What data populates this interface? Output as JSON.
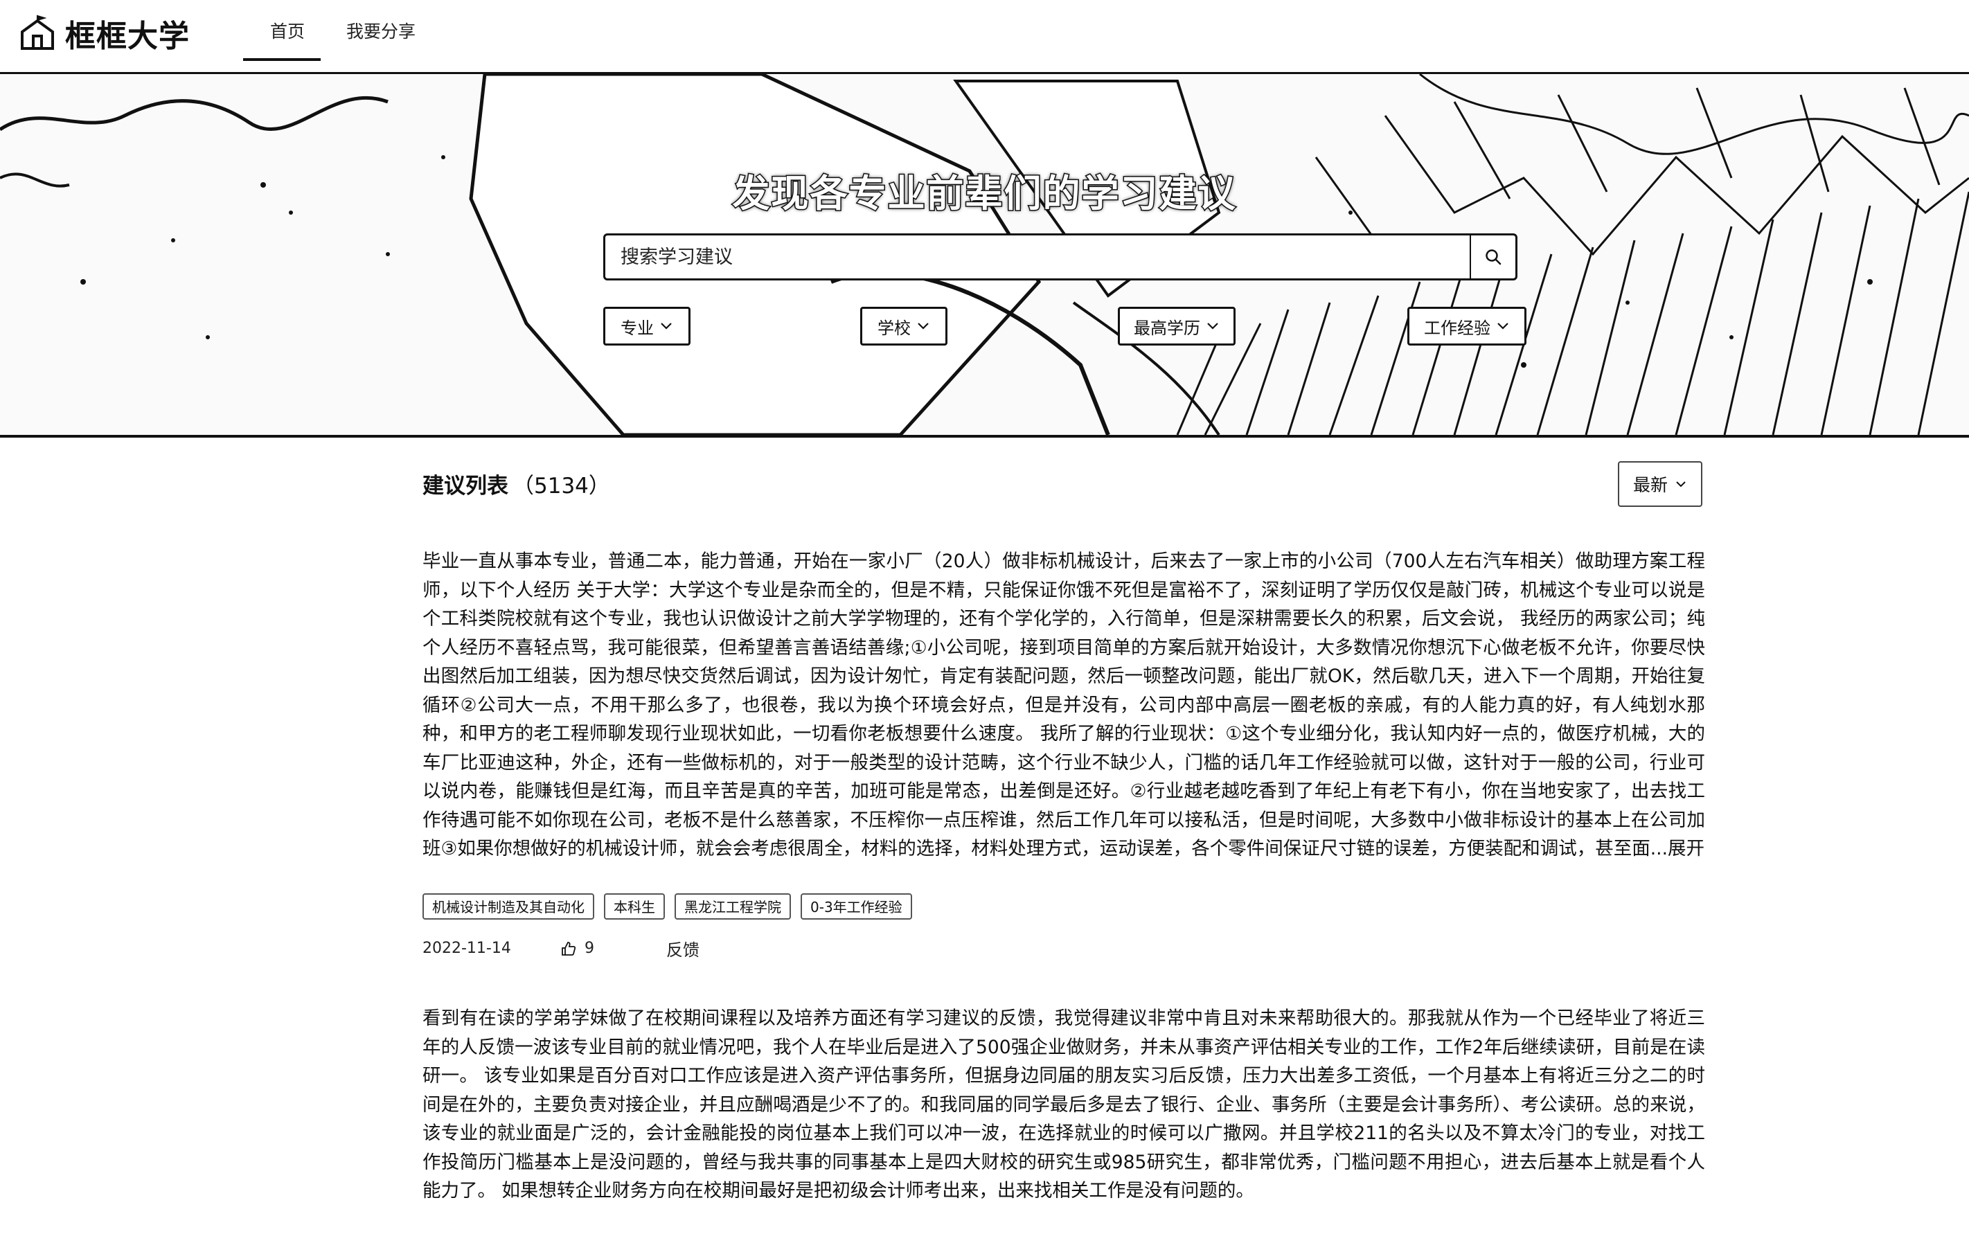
{
  "app": {
    "logo_text": "框框大学",
    "nav": [
      {
        "label": "首页",
        "active": true
      },
      {
        "label": "我要分享",
        "active": false
      }
    ]
  },
  "hero": {
    "title": "发现各专业前辈们的学习建议",
    "search": {
      "placeholder": "搜索学习建议",
      "value": ""
    },
    "filters": [
      "专业",
      "学校",
      "最高学历",
      "工作经验"
    ]
  },
  "list": {
    "title": "建议列表",
    "count": "（5134）",
    "sort_label": "最新",
    "posts": [
      {
        "text": "毕业一直从事本专业，普通二本，能力普通，开始在一家小厂（20人）做非标机械设计，后来去了一家上市的小公司（700人左右汽车相关）做助理方案工程师，以下个人经历 关于大学：大学这个专业是杂而全的，但是不精，只能保证你饿不死但是富裕不了，深刻证明了学历仅仅是敲门砖，机械这个专业可以说是个工科类院校就有这个专业，我也认识做设计之前大学学物理的，还有个学化学的，入行简单，但是深耕需要长久的积累，后文会说， 我经历的两家公司；纯个人经历不喜轻点骂，我可能很菜，但希望善言善语结善缘;①小公司呢，接到项目简单的方案后就开始设计，大多数情况你想沉下心做老板不允许，你要尽快出图然后加工组装，因为想尽快交货然后调试，因为设计匆忙，肯定有装配问题，然后一顿整改问题，能出厂就OK，然后歇几天，进入下一个周期，开始往复循环②公司大一点，不用干那么多了，也很卷，我以为换个环境会好点，但是并没有，公司内部中高层一圈老板的亲戚，有的人能力真的好，有人纯划水那种，和甲方的老工程师聊发现行业现状如此，一切看你老板想要什么速度。 我所了解的行业现状：①这个专业细分化，我认知内好一点的，做医疗机械，大的车厂比亚迪这种，外企，还有一些做标机的，对于一般类型的设计范畴，这个行业不缺少人，门槛的话几年工作经验就可以做，这针对于一般的公司，行业可以说内卷，能赚钱但是红海，而且辛苦是真的辛苦，加班可能是常态，出差倒是还好。②行业越老越吃香到了年纪上有老下有小，你在当地安家了，出去找工作待遇可能不如你现在公司，老板不是什么慈善家，不压榨你一点压榨谁，然后工作几年可以接私活，但是时间呢，大多数中小做非标设计的基本上在公司加班③如果你想做好的机械设计师，就会会考虑很周全，材料的选择，材料处理方式，运动误差，各个零件间保证尺寸链的误差，方便装配和调试，甚至面...",
        "expand_label": "展开",
        "tags": [
          "机械设计制造及其自动化",
          "本科生",
          "黑龙江工程学院",
          "0-3年工作经验"
        ],
        "date": "2022-11-14",
        "likes": "9",
        "feedback_label": "反馈"
      },
      {
        "text": "看到有在读的学弟学妹做了在校期间课程以及培养方面还有学习建议的反馈，我觉得建议非常中肯且对未来帮助很大的。那我就从作为一个已经毕业了将近三年的人反馈一波该专业目前的就业情况吧，我个人在毕业后是进入了500强企业做财务，并未从事资产评估相关专业的工作，工作2年后继续读研，目前是在读研一。 该专业如果是百分百对口工作应该是进入资产评估事务所，但据身边同届的朋友实习后反馈，压力大出差多工资低，一个月基本上有将近三分之二的时间是在外的，主要负责对接企业，并且应酬喝酒是少不了的。和我同届的同学最后多是去了银行、企业、事务所（主要是会计事务所）、考公读研。总的来说，该专业的就业面是广泛的，会计金融能投的岗位基本上我们可以冲一波，在选择就业的时候可以广撒网。并且学校211的名头以及不算太冷门的专业，对找工作投简历门槛基本上是没问题的，曾经与我共事的同事基本上是四大财校的研究生或985研究生，都非常优秀，门槛问题不用担心，进去后基本上就是看个人能力了。 如果想转企业财务方向在校期间最好是把初级会计师考出来，出来找相关工作是没有问题的。"
      }
    ]
  }
}
